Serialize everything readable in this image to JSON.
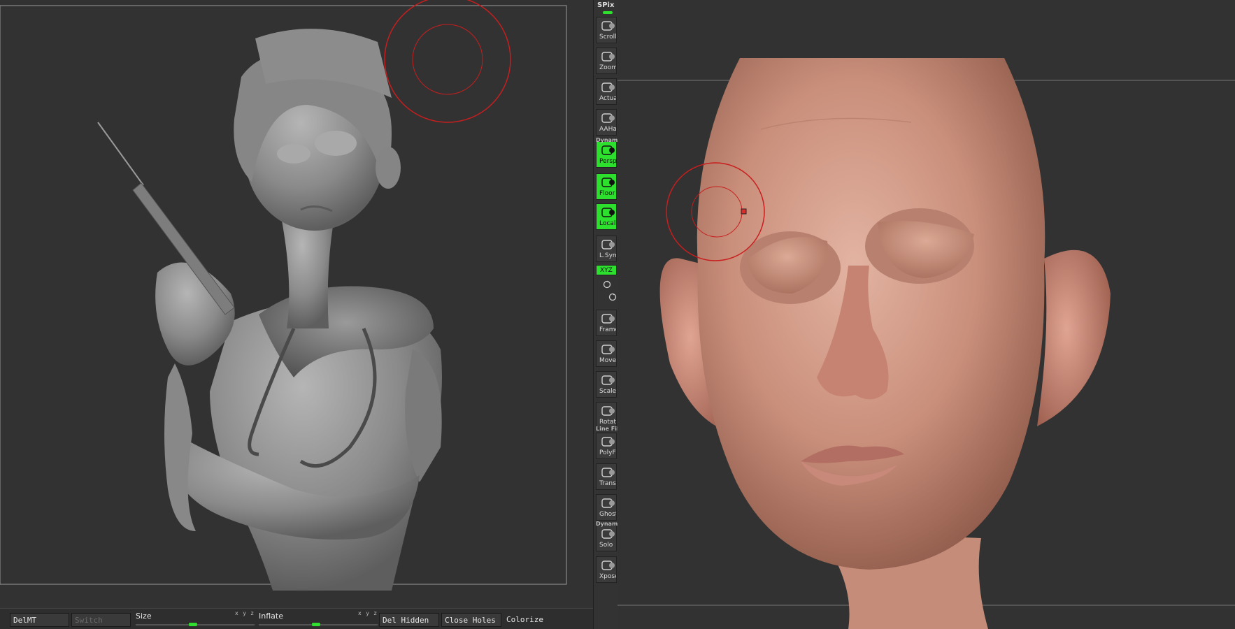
{
  "bottom_bar": {
    "delmt": "DelMT",
    "switch": "Switch",
    "size_label": "Size",
    "size_axes": "x y z",
    "inflate_label": "Inflate",
    "inflate_axes": "x y z",
    "del_hidden": "Del Hidden",
    "close_holes": "Close Holes",
    "colorize": "Colorize"
  },
  "tool_strip": {
    "spix": "SPix",
    "buttons": [
      {
        "label": "Scroll",
        "icon": "hand-icon",
        "active": false
      },
      {
        "label": "Zoom",
        "icon": "magnifier-icon",
        "active": false
      },
      {
        "label": "Actual",
        "icon": "magnifier-icon",
        "active": false
      },
      {
        "label": "AAHalf",
        "icon": "magnifier-icon",
        "active": false
      },
      {
        "label": "Persp",
        "icon": "grid-icon",
        "active": true
      },
      {
        "label": "Floor",
        "icon": "floor-icon",
        "active": true
      },
      {
        "label": "Local",
        "icon": "local-icon",
        "active": true
      },
      {
        "label": "L.Sym",
        "icon": "sym-icon",
        "active": false
      },
      {
        "label": "Frame",
        "icon": "frame-icon",
        "active": false
      },
      {
        "label": "Move",
        "icon": "hand-icon",
        "active": false
      },
      {
        "label": "Scale",
        "icon": "scale-icon",
        "active": false
      },
      {
        "label": "Rotate",
        "icon": "rotate-icon",
        "active": false
      },
      {
        "label": "PolyF",
        "icon": "polyframe-icon",
        "active": false
      },
      {
        "label": "Transp",
        "icon": "transp-icon",
        "active": false
      },
      {
        "label": "Ghost",
        "icon": "ghost-icon",
        "active": false
      },
      {
        "label": "Solo",
        "icon": "solo-icon",
        "active": false
      },
      {
        "label": "Xpose",
        "icon": "xpose-icon",
        "active": false
      }
    ],
    "dynamic_label": "Dynamic",
    "line_fill_label": "Line Fill",
    "dynamic2_label": "Dynamic",
    "xyz_label": "XYZ"
  },
  "colors": {
    "accent_green": "#2ee02e",
    "brush_ring": "#c81e1e",
    "canvas_bg": "#323232",
    "clay": "#8e8e8e",
    "skin": "#d39a86"
  }
}
